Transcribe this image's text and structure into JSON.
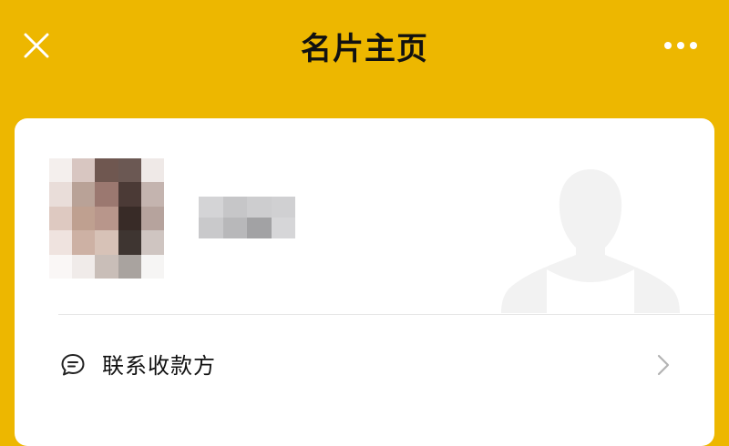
{
  "header": {
    "title": "名片主页",
    "close_icon": "close-icon",
    "more_icon": "more-dots-icon"
  },
  "card": {
    "contact_row": {
      "label": "联系收款方",
      "icon": "chat-bubble-icon",
      "chevron_icon": "chevron-right-icon"
    }
  },
  "colors": {
    "header_background": "#EDB700",
    "card_background": "#FFFFFF",
    "silhouette": "#F2F2F2"
  }
}
